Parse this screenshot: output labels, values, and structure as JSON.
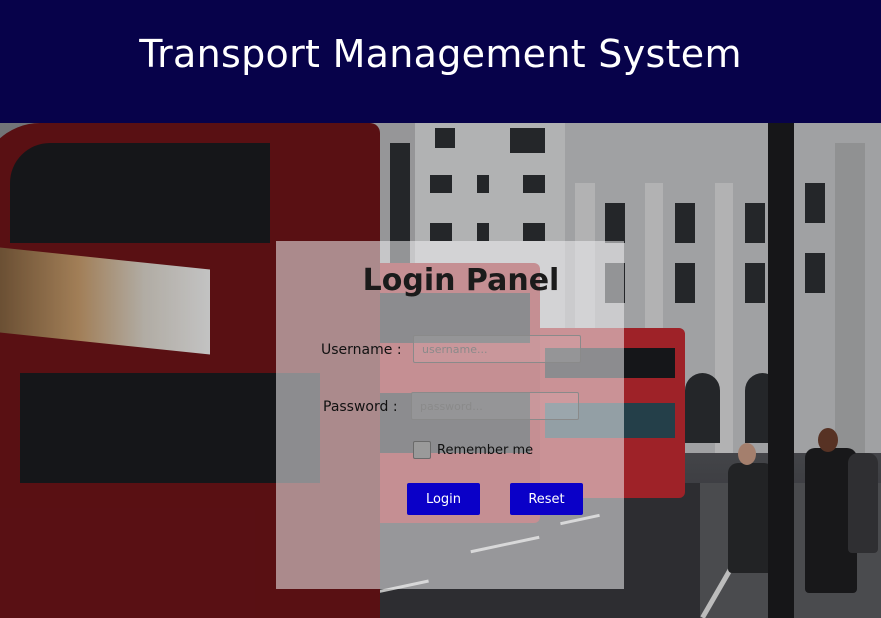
{
  "header": {
    "title": "Transport Management System",
    "background_color": "#07024a"
  },
  "login_panel": {
    "title": "Login Panel",
    "username_label": "Username :",
    "username_placeholder": "username...",
    "password_label": "Password :",
    "password_placeholder": "password...",
    "remember_label": "Remember me",
    "remember_checked": false,
    "login_button": "Login",
    "reset_button": "Reset",
    "button_color": "#0a00c8"
  }
}
